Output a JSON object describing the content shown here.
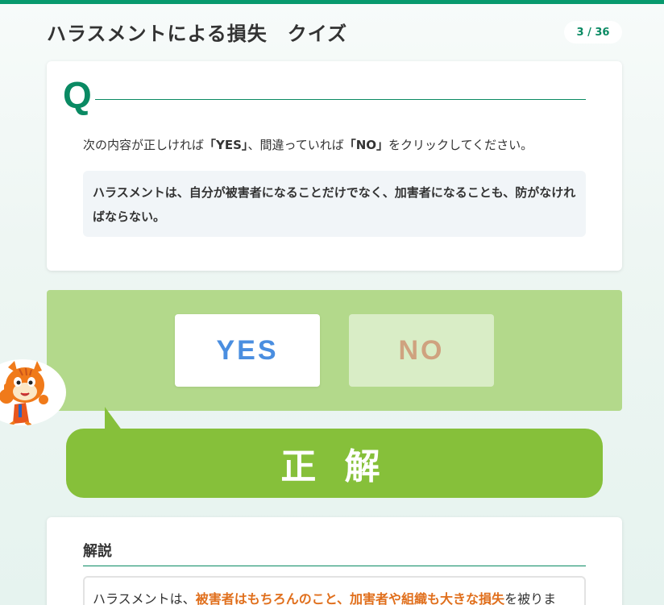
{
  "header": {
    "title": "ハラスメントによる損失　クイズ",
    "progress": "3 / 36",
    "accent": "#079a6e"
  },
  "question": {
    "mark": "Q",
    "instruction": {
      "part1": "次の内容が正しければ",
      "yes": "「YES」",
      "part2": "、間違っていれば",
      "no": "「NO」",
      "part3": "をクリックしてください。"
    },
    "statement": "ハラスメントは、自分が被害者になることだけでなく、加害者になることも、防がなければならない。"
  },
  "answers": {
    "yes_label": "YES",
    "no_label": "NO",
    "panel_color": "#b3d98b"
  },
  "mascot": {
    "icon": "cat-mascot-thumbs-up-icon"
  },
  "result": {
    "label": "正 解",
    "color": "#86c03a"
  },
  "explanation": {
    "heading": "解説",
    "text_start": "ハラスメントは、",
    "text_highlight": "被害者はもちろんのこと、加害者や組織も大きな損失",
    "text_end": "を被りま",
    "highlight_color": "#e06f1c"
  }
}
